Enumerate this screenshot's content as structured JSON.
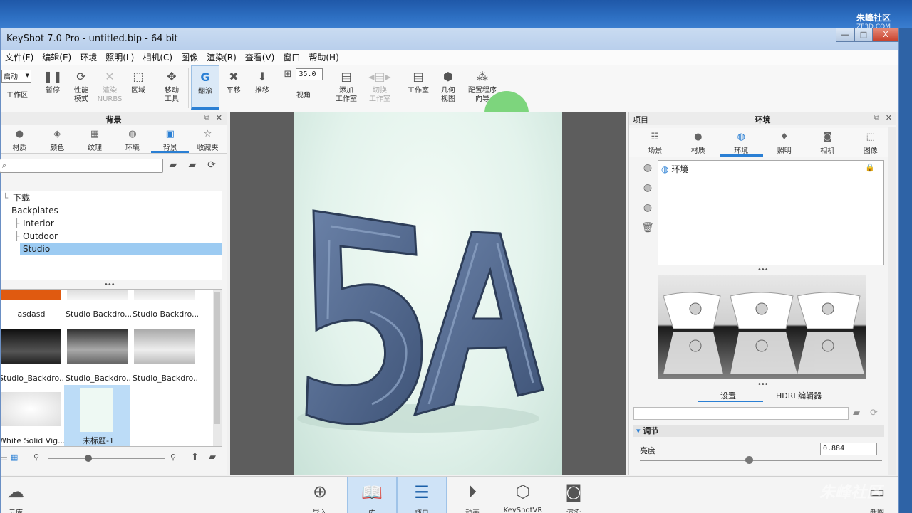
{
  "window": {
    "title": "KeyShot 7.0 Pro  - untitled.bip - 64 bit",
    "min": "—",
    "max": "□",
    "close": "X"
  },
  "watermark": {
    "top": "朱峰社区",
    "top_sub": "ZF3D.COM",
    "bottom": "朱峰社区"
  },
  "menu": [
    "文件(F)",
    "编辑(E)",
    "环境",
    "照明(L)",
    "相机(C)",
    "图像",
    "渲染(R)",
    "查看(V)",
    "窗口",
    "帮助(H)"
  ],
  "toolbar": {
    "start_select": "启动",
    "workspace": "工作区",
    "pause": "暂停",
    "perf_mode": "性能\n模式",
    "nurbs": "渲染\nNURBS",
    "region": "区域",
    "move_tool": "移动\n工具",
    "tumble": "翻滚",
    "pan": "平移",
    "dolly": "推移",
    "fov_value": "35.0",
    "fov": "视角",
    "add_camera": "添加\n工作室",
    "switch": "切换\n工作室",
    "studio": "工作室",
    "geometry_view": "几何\n视图",
    "configurator": "配置程序\n向导"
  },
  "left_panel": {
    "title": "背景",
    "tabs": [
      "材质",
      "颜色",
      "纹理",
      "环境",
      "背景",
      "收藏夹"
    ],
    "tree": [
      {
        "label": "下载",
        "indent": 0
      },
      {
        "label": "Backplates",
        "indent": 0
      },
      {
        "label": "Interior",
        "indent": 1
      },
      {
        "label": "Outdoor",
        "indent": 1
      },
      {
        "label": "Studio",
        "indent": 1
      }
    ],
    "thumbs": [
      {
        "label": "asdasd"
      },
      {
        "label": "Studio Backdro..."
      },
      {
        "label": "Studio Backdro..."
      },
      {
        "label": "Studio_Backdro..."
      },
      {
        "label": "Studio_Backdro..."
      },
      {
        "label": "Studio_Backdro..."
      },
      {
        "label": "White Solid Vig..."
      },
      {
        "label": "未标题-1"
      }
    ]
  },
  "viewport": {
    "render_text": "5A"
  },
  "right_panel": {
    "left_title": "项目",
    "title": "环境",
    "tabs": [
      "场景",
      "材质",
      "环境",
      "照明",
      "相机",
      "图像"
    ],
    "env_item": "环境",
    "sub_tabs": [
      "设置",
      "HDRI 编辑器"
    ],
    "adjust": "调节",
    "brightness_label": "亮度",
    "brightness_value": "0.884",
    "brightness_level": 0.45
  },
  "bottom_bar": [
    "导入",
    "库",
    "项目",
    "动画",
    "KeyShotVR",
    "渲染"
  ],
  "bottom_left": "云库",
  "bottom_right": "截图"
}
